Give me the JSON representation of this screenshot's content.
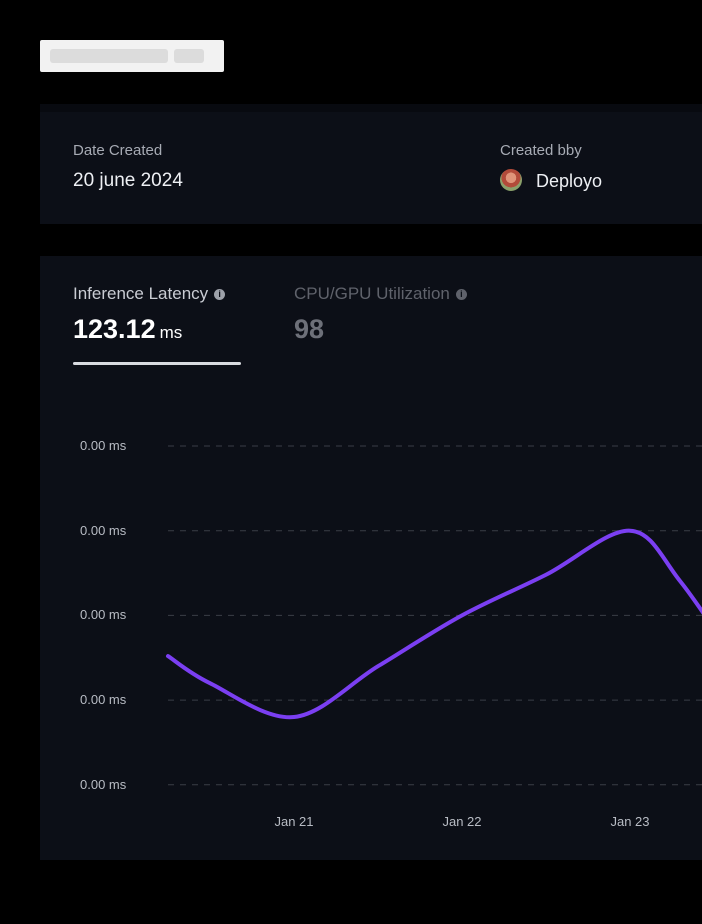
{
  "header": {
    "title": ""
  },
  "details": {
    "date_created_label": "Date Created",
    "date_created_value": "20 june 2024",
    "created_by_label": "Created bby",
    "created_by_value": "Deployo"
  },
  "metrics": {
    "tabs": [
      {
        "label": "Inference Latency",
        "value": "123.12",
        "unit": "ms",
        "active": true
      },
      {
        "label": "CPU/GPU Utilization",
        "value": "98",
        "unit": "",
        "active": false
      }
    ]
  },
  "colors": {
    "accent_line": "#7b3ff2",
    "active_text": "#ffffff",
    "inactive_text": "#6d7079"
  },
  "chart_data": {
    "type": "line",
    "title": "",
    "xlabel": "",
    "ylabel": "",
    "y_tick_labels": [
      "0.00 ms",
      "0.00 ms",
      "0.00 ms",
      "0.00 ms",
      "0.00 ms"
    ],
    "x_tick_labels": [
      "Jan 21",
      "Jan 22",
      "Jan 23"
    ],
    "grid": "horizontal-dashed",
    "series": [
      {
        "values_relative_to_top_gridline": [
          [
            -0.75,
            0.38
          ],
          [
            -0.5,
            0.3
          ],
          [
            0.0,
            0.2
          ],
          [
            0.5,
            0.35
          ],
          [
            1.0,
            0.5
          ],
          [
            1.5,
            0.62
          ],
          [
            2.0,
            0.75
          ],
          [
            2.3,
            0.6
          ],
          [
            2.65,
            0.35
          ]
        ]
      }
    ]
  }
}
